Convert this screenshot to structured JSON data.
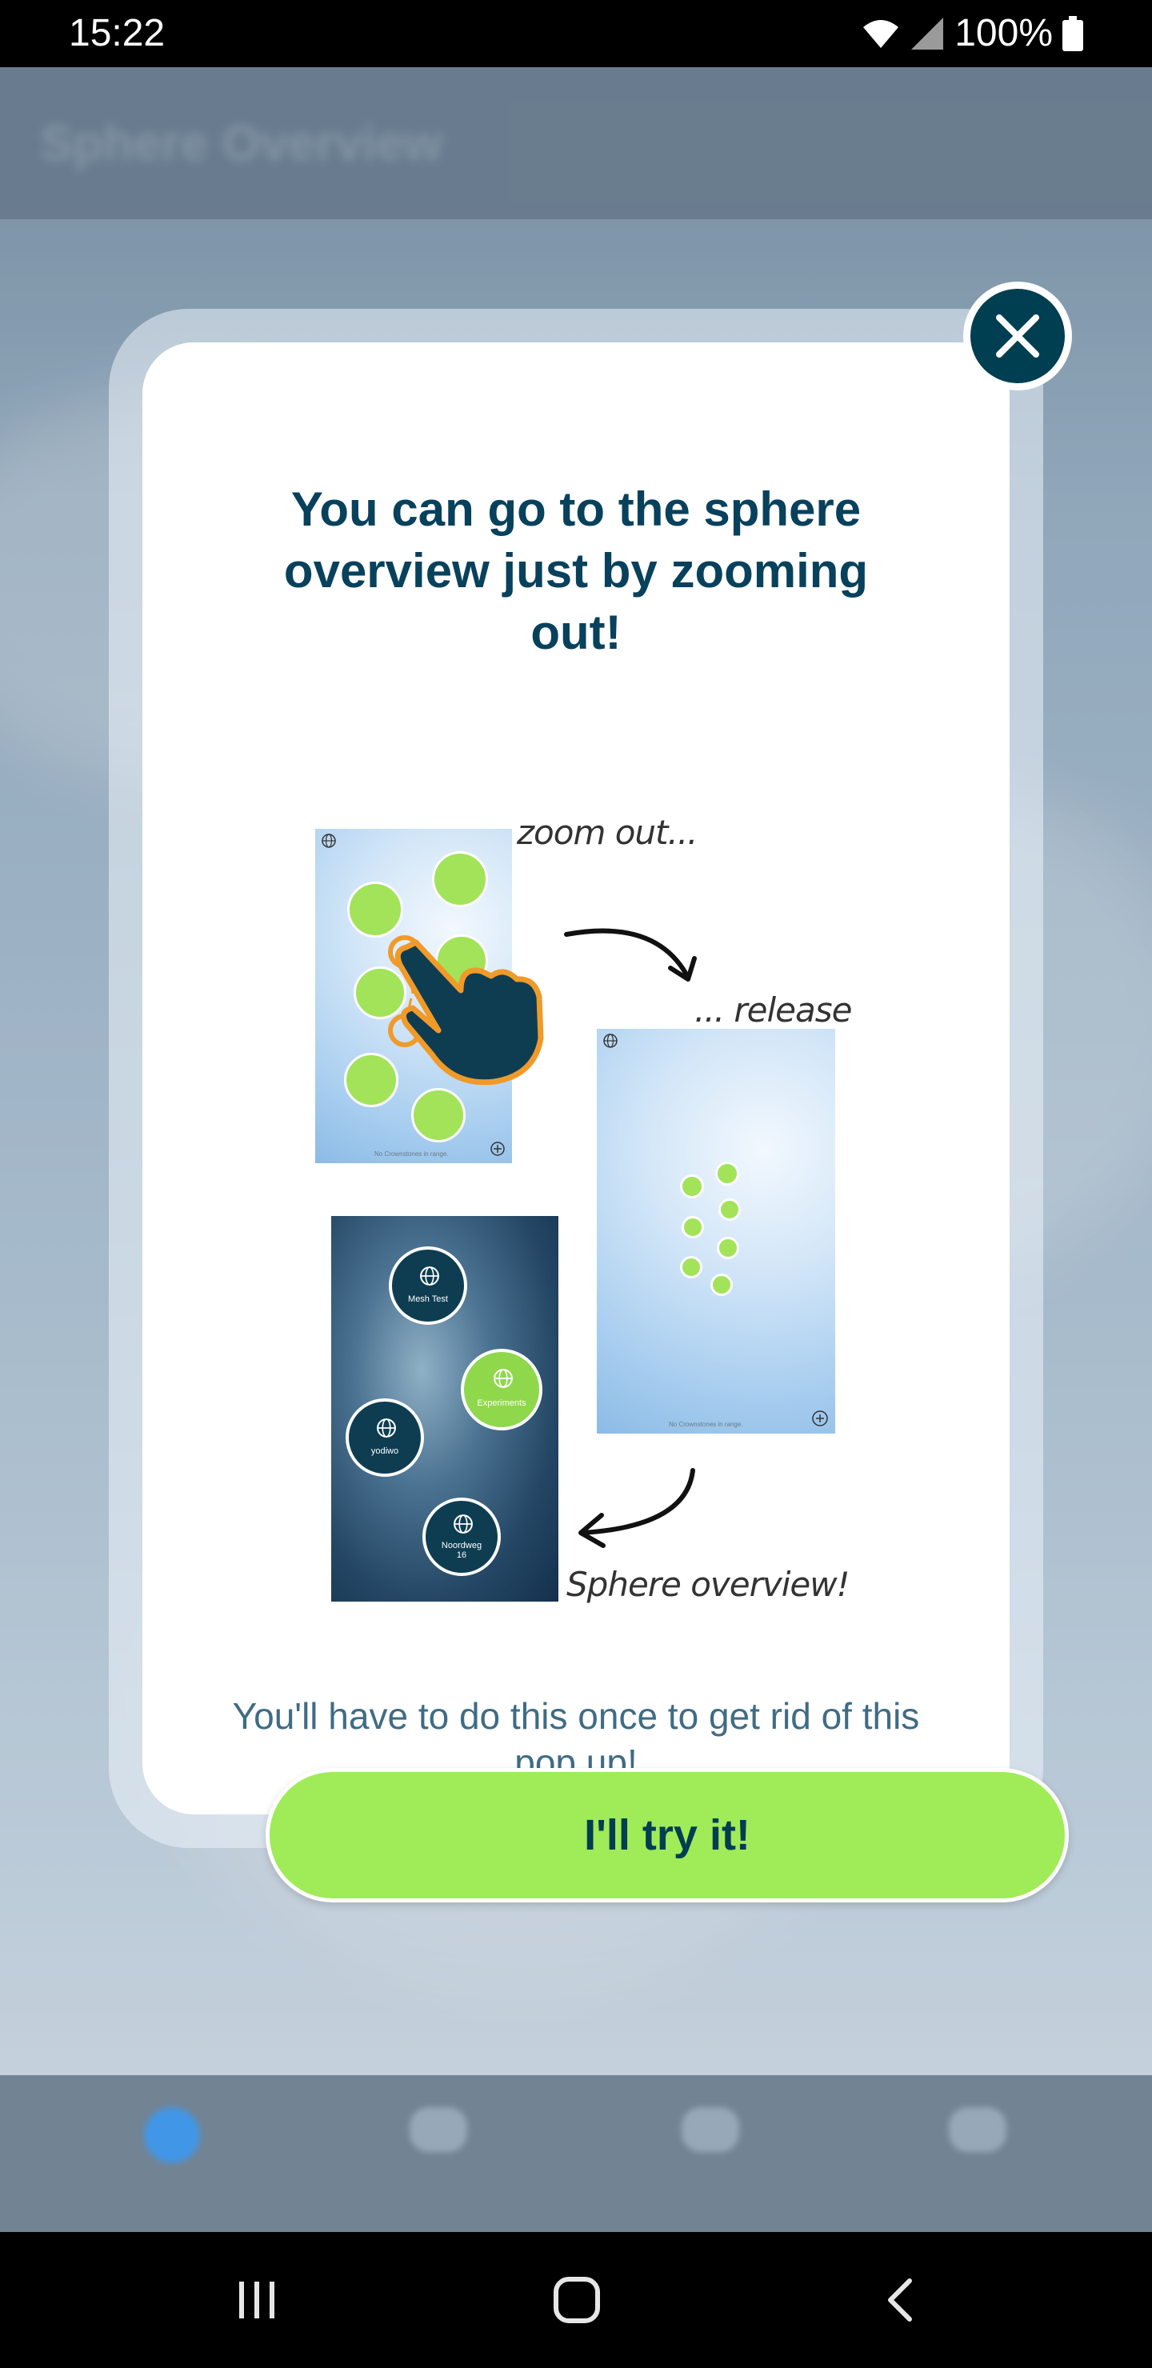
{
  "status_bar": {
    "time": "15:22",
    "battery": "100%"
  },
  "background": {
    "title": "Sphere Overview"
  },
  "modal": {
    "title": "You can go to the sphere overview just by zooming out!",
    "body_text": "You'll have to do this once to get rid of this pop up!",
    "primary_button_label": "I'll try it!",
    "close_icon": "close-icon"
  },
  "illustration": {
    "caption_zoom_out": "zoom out...",
    "caption_release": "... release",
    "caption_sphere_overview": "Sphere overview!",
    "no_crownstones_text": "No Crownstones in range.",
    "spheres": [
      "Mesh Test",
      "Experiments",
      "yodiwo",
      "Noordweg 16"
    ]
  },
  "colors": {
    "dark_blue": "#003e52",
    "green": "#a0eb58",
    "title": "#08415c"
  }
}
